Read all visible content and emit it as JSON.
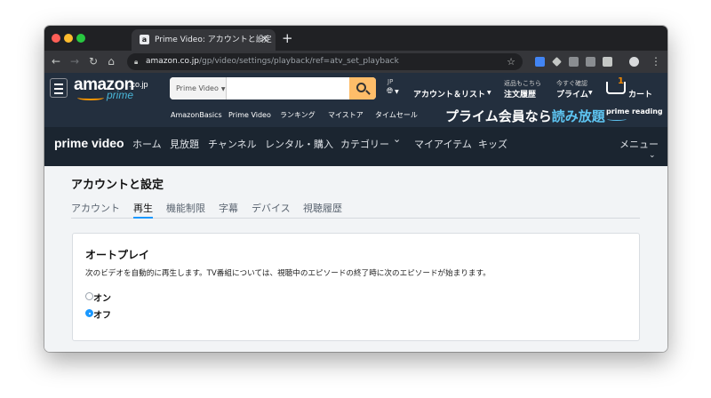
{
  "browser": {
    "tab_title": "Prime Video: アカウントと設定",
    "favicon": "a",
    "close_glyph": "✕",
    "new_tab_glyph": "+",
    "url_host": "amazon.co.jp",
    "url_path": "/gp/video/settings/playback/ref=atv_set_playback",
    "traffic_colors": [
      "#ff5f57",
      "#febc2e",
      "#28c840"
    ]
  },
  "amazon_header": {
    "logo_text": "amazon",
    "logo_tld": ".co.jp",
    "logo_prime": "prime",
    "search_scope": "Prime Video",
    "search_value": "",
    "lang_code": "JP",
    "lang_icon": "globe-icon",
    "account_label": "アカウント＆リスト",
    "returns_top": "返品もこちら",
    "returns_bottom": "注文履歴",
    "prime_top": "今すぐ確認",
    "prime_bottom": "プライム",
    "cart_count": "1",
    "cart_label": "カート",
    "subnav": [
      "AmazonBasics",
      "Prime Video",
      "ランキング",
      "マイストア",
      "タイムセール"
    ],
    "promo_text": "プライム会員なら",
    "promo_accent": "読み放題",
    "prime_reading": "prime reading",
    "brand_color": "#ff9900",
    "accent_color": "#5ec5f2"
  },
  "prime_nav": {
    "logo": "prime video",
    "items": [
      "ホーム",
      "見放題",
      "チャンネル",
      "レンタル・購入",
      "カテゴリー",
      "マイアイテム",
      "キッズ"
    ],
    "category_chevron": "⌄",
    "menu": "メニュー",
    "menu_chevron": "⌄"
  },
  "page": {
    "title": "アカウントと設定",
    "tabs": [
      "アカウント",
      "再生",
      "機能制限",
      "字幕",
      "デバイス",
      "視聴履歴"
    ],
    "active_tab": "再生",
    "autoplay": {
      "heading": "オートプレイ",
      "description": "次のビデオを自動的に再生します。TV番組については、視聴中のエピソードの終了時に次のエピソードが始まります。",
      "options": [
        "オン",
        "オフ"
      ],
      "selected": "オフ"
    }
  }
}
